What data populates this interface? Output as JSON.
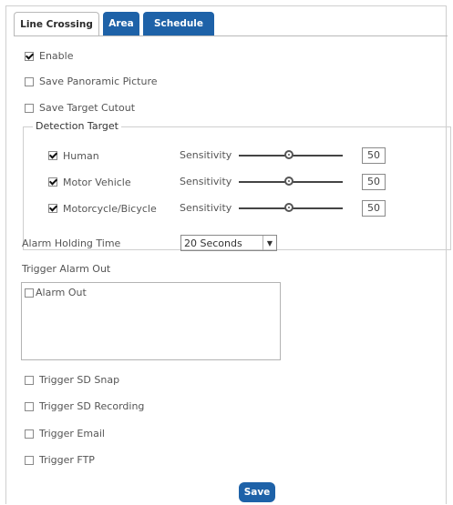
{
  "tabs": [
    {
      "label": "Line Crossing",
      "active": true
    },
    {
      "label": "Area",
      "active": false
    },
    {
      "label": "Schedule",
      "active": false
    }
  ],
  "options": {
    "enable": {
      "label": "Enable",
      "checked": true
    },
    "save_panoramic": {
      "label": "Save Panoramic Picture",
      "checked": false
    },
    "save_target_cutout": {
      "label": "Save Target Cutout",
      "checked": false
    }
  },
  "detection_target": {
    "title": "Detection Target",
    "items": [
      {
        "label": "Human",
        "checked": true,
        "sensitivity_label": "Sensitivity",
        "value": "50"
      },
      {
        "label": "Motor Vehicle",
        "checked": true,
        "sensitivity_label": "Sensitivity",
        "value": "50"
      },
      {
        "label": "Motorcycle/Bicycle",
        "checked": true,
        "sensitivity_label": "Sensitivity",
        "value": "50"
      }
    ]
  },
  "alarm_holding": {
    "label": "Alarm Holding Time",
    "value": "20 Seconds"
  },
  "trigger_alarm_out": {
    "label": "Trigger Alarm Out",
    "items": [
      {
        "label": "Alarm Out",
        "checked": false
      }
    ]
  },
  "triggers": [
    {
      "label": "Trigger SD Snap",
      "checked": false
    },
    {
      "label": "Trigger SD Recording",
      "checked": false
    },
    {
      "label": "Trigger Email",
      "checked": false
    },
    {
      "label": "Trigger FTP",
      "checked": false
    }
  ],
  "save_button": "Save",
  "colors": {
    "accent": "#1e62a8"
  }
}
